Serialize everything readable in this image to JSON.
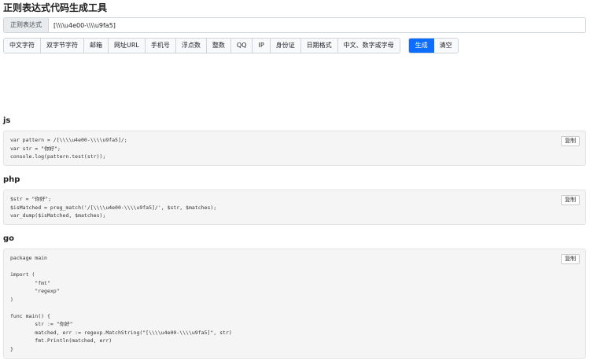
{
  "page_title": "正则表达式代码生成工具",
  "regex_input": {
    "label": "正则表达式",
    "value": "[\\\\\\\\u4e00-\\\\\\\\u9fa5]"
  },
  "presets": [
    "中文字符",
    "双字节字符",
    "邮箱",
    "网址URL",
    "手机号",
    "浮点数",
    "整数",
    "QQ",
    "IP",
    "身份证",
    "日期格式",
    "中文、数字或字母"
  ],
  "actions": {
    "generate": "生成",
    "clear": "清空"
  },
  "sections": [
    {
      "lang": "js",
      "copy_label": "复制",
      "code": "var pattern = /[\\\\\\\\u4e00-\\\\\\\\u9fa5]/;\nvar str = \"你好\";\nconsole.log(pattern.test(str));"
    },
    {
      "lang": "php",
      "copy_label": "复制",
      "code": "$str = \"你好\";\n$isMatched = preg_match('/[\\\\\\\\u4e00-\\\\\\\\u9fa5]/', $str, $matches);\nvar_dump($isMatched, $matches);"
    },
    {
      "lang": "go",
      "copy_label": "复制",
      "code": "package main\n\nimport (\n        \"fmt\"\n        \"regexp\"\n)\n\nfunc main() {\n        str := \"你好\"\n        matched, err := regexp.MatchString(\"[\\\\\\\\u4e00-\\\\\\\\u9fa5]\", str)\n        fmt.Println(matched, err)\n}"
    }
  ]
}
